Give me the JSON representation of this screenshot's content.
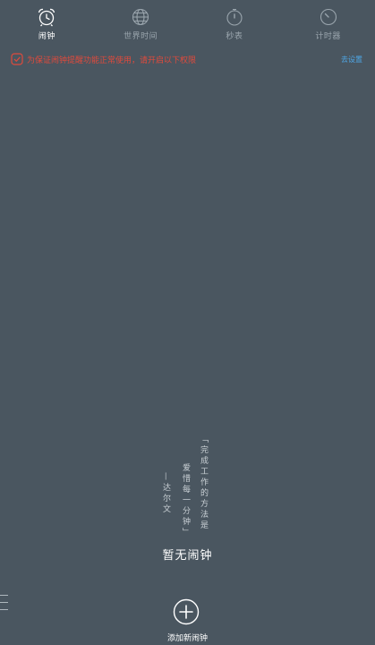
{
  "tabs": [
    {
      "label": "闹钟",
      "icon": "alarm-clock-icon",
      "active": true
    },
    {
      "label": "世界时间",
      "icon": "globe-icon",
      "active": false
    },
    {
      "label": "秒表",
      "icon": "stopwatch-icon",
      "active": false
    },
    {
      "label": "计时器",
      "icon": "timer-icon",
      "active": false
    }
  ],
  "banner": {
    "icon": "warning-shield-icon",
    "text": "为保证闹钟提醒功能正常使用，请开启以下权限",
    "action": "去设置",
    "text_color": "#e04a3c",
    "action_color": "#4ea8e8"
  },
  "quote": {
    "line1": "「完成工作的方法是",
    "line2": "爱惜每一分钟」",
    "author": "—达尔文"
  },
  "empty": {
    "title": "暂无闹钟"
  },
  "add": {
    "label": "添加新闹钟",
    "icon": "plus-circle-icon"
  },
  "colors": {
    "background": "#4a5660",
    "text": "#ffffff"
  }
}
